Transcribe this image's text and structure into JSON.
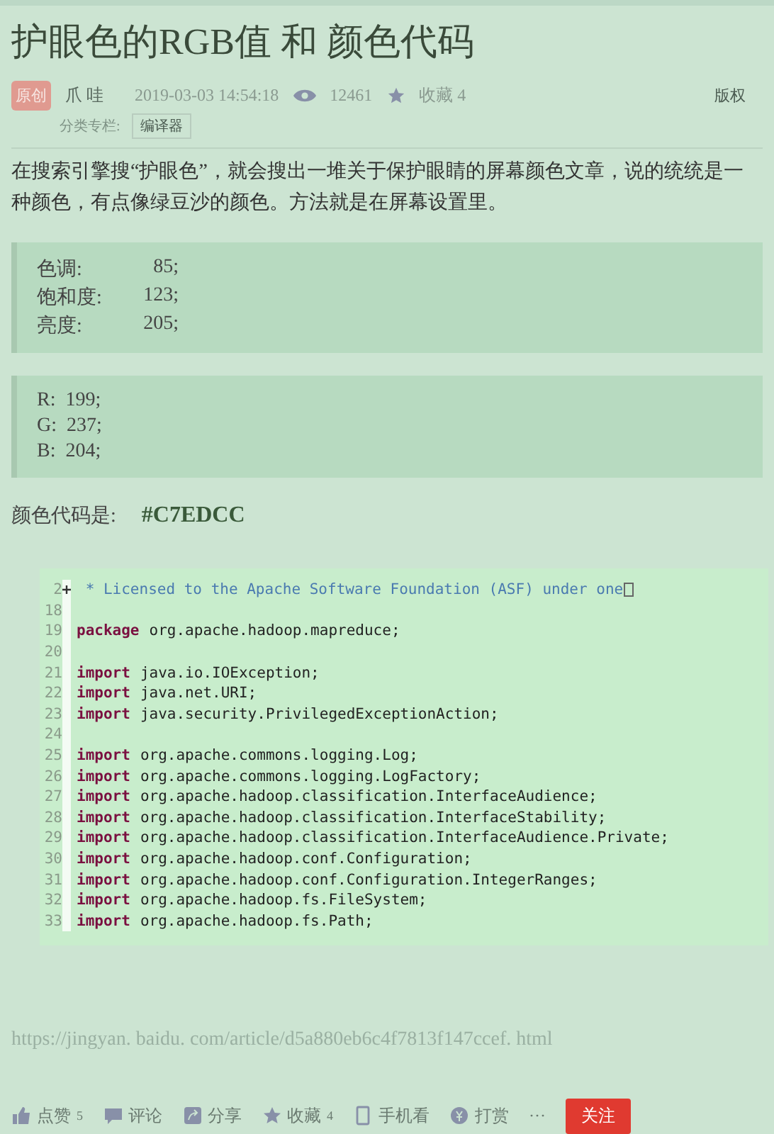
{
  "title": "护眼色的RGB值  和  颜色代码",
  "meta": {
    "badge": "原创",
    "author": "爪 哇",
    "date": "2019-03-03 14:54:18",
    "views": "12461",
    "favorites": "收藏 4",
    "copyright": "版权",
    "category_label": "分类专栏:",
    "category": "编译器"
  },
  "intro": "在搜索引擎搜“护眼色”，就会搜出一堆关于保护眼睛的屏幕颜色文章，说的统统是一种颜色，有点像绿豆沙的颜色。方法就是在屏幕设置里。",
  "hsl_block": [
    {
      "label": "色调:",
      "value": "85;"
    },
    {
      "label": "饱和度:",
      "value": "123;"
    },
    {
      "label": "亮度:",
      "value": "205;"
    }
  ],
  "rgb_block": [
    "R:  199;",
    "G:  237;",
    "B:  204;"
  ],
  "color_code": {
    "label": "颜色代码是:",
    "value": "#C7EDCC"
  },
  "code": [
    {
      "number": "2",
      "kind": "comment",
      "fold": true,
      "text": " * Licensed to the Apache Software Foundation (ASF) under one",
      "collapsed": true
    },
    {
      "number": "18",
      "kind": "blank"
    },
    {
      "number": "19",
      "kind": "statement",
      "keyword": "package",
      "text": "org.apache.hadoop.mapreduce;"
    },
    {
      "number": "20",
      "kind": "blank"
    },
    {
      "number": "21",
      "kind": "statement",
      "keyword": "import",
      "text": "java.io.IOException;"
    },
    {
      "number": "22",
      "kind": "statement",
      "keyword": "import",
      "text": "java.net.URI;"
    },
    {
      "number": "23",
      "kind": "statement",
      "keyword": "import",
      "text": "java.security.PrivilegedExceptionAction;"
    },
    {
      "number": "24",
      "kind": "blank"
    },
    {
      "number": "25",
      "kind": "statement",
      "keyword": "import",
      "text": "org.apache.commons.logging.Log;"
    },
    {
      "number": "26",
      "kind": "statement",
      "keyword": "import",
      "text": "org.apache.commons.logging.LogFactory;"
    },
    {
      "number": "27",
      "kind": "statement",
      "keyword": "import",
      "text": "org.apache.hadoop.classification.InterfaceAudience;"
    },
    {
      "number": "28",
      "kind": "statement",
      "keyword": "import",
      "text": "org.apache.hadoop.classification.InterfaceStability;"
    },
    {
      "number": "29",
      "kind": "statement",
      "keyword": "import",
      "text": "org.apache.hadoop.classification.InterfaceAudience.Private;"
    },
    {
      "number": "30",
      "kind": "statement",
      "keyword": "import",
      "text": "org.apache.hadoop.conf.Configuration;"
    },
    {
      "number": "31",
      "kind": "statement",
      "keyword": "import",
      "text": "org.apache.hadoop.conf.Configuration.IntegerRanges;"
    },
    {
      "number": "32",
      "kind": "statement",
      "keyword": "import",
      "text": "org.apache.hadoop.fs.FileSystem;"
    },
    {
      "number": "33",
      "kind": "statement",
      "keyword": "import",
      "text": "org.apache.hadoop.fs.Path;"
    }
  ],
  "url": "https://jingyan. baidu. com/article/d5a880eb6c4f7813f147ccef. html",
  "toolbar": [
    {
      "kind": "like",
      "label": "点赞",
      "count": "5"
    },
    {
      "kind": "comment",
      "label": "评论"
    },
    {
      "kind": "share",
      "label": "分享"
    },
    {
      "kind": "star",
      "label": "收藏",
      "count": "4"
    },
    {
      "kind": "phone",
      "label": "手机看"
    },
    {
      "kind": "reward",
      "label": "打赏"
    },
    {
      "kind": "more",
      "label": "···"
    }
  ],
  "follow_button": "关注"
}
